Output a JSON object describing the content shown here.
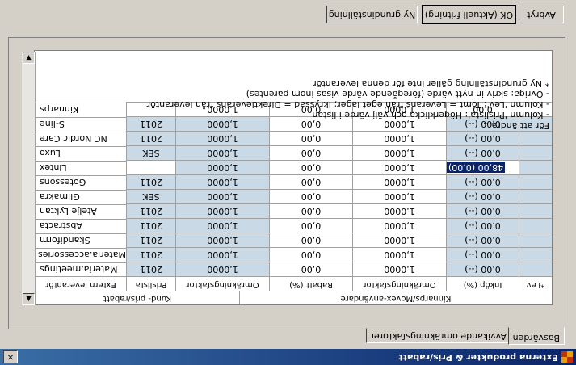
{
  "window": {
    "title": "Externa produkter & Pris/rabatt",
    "close_glyph": "×"
  },
  "tabs": [
    {
      "label": "Basvärden"
    },
    {
      "label": "Avvikande omräkningsfaktorer"
    }
  ],
  "grid": {
    "group_headers": [
      "Kinnarps/Movex-användare",
      "Kund- pris/rabatt"
    ],
    "columns": [
      "*Lev",
      "Inköp (%)",
      "Omräkningsfaktor",
      "Rabatt (%)",
      "Omräkningsfaktor",
      "Prislista",
      "Extern leverantör"
    ],
    "rows": [
      {
        "lev": "",
        "inkop": "0,00 (--)",
        "omr1": "1,0000",
        "rabatt": "0,00",
        "omr2": "1,0000",
        "prislista": "2011",
        "extern": "Materia.meetings"
      },
      {
        "lev": "",
        "inkop": "0,00 (--)",
        "omr1": "1,0000",
        "rabatt": "0,00",
        "omr2": "1,0000",
        "prislista": "2011",
        "extern": "Materia.accessories"
      },
      {
        "lev": "",
        "inkop": "0,00 (--)",
        "omr1": "1,0000",
        "rabatt": "0,00",
        "omr2": "1,0000",
        "prislista": "2011",
        "extern": "Skandiform"
      },
      {
        "lev": "",
        "inkop": "0,00 (--)",
        "omr1": "1,0000",
        "rabatt": "0,00",
        "omr2": "1,0000",
        "prislista": "2011",
        "extern": "Abstracta"
      },
      {
        "lev": "",
        "inkop": "0,00 (--)",
        "omr1": "1,0000",
        "rabatt": "0,00",
        "omr2": "1,0000",
        "prislista": "2011",
        "extern": "Atelje Lyktan"
      },
      {
        "lev": "",
        "inkop": "0,00 (--)",
        "omr1": "1,0000",
        "rabatt": "0,00",
        "omr2": "1,0000",
        "prislista": "SEK",
        "extern": "Glimakra"
      },
      {
        "lev": "",
        "inkop": "0,00 (--)",
        "omr1": "1,0000",
        "rabatt": "0,00",
        "omr2": "1,0000",
        "prislista": "2011",
        "extern": "Gotessons"
      },
      {
        "lev": "",
        "inkop": "48,00 (0,00)",
        "omr1": "1,0000",
        "rabatt": "0,00",
        "omr2": "1,0000",
        "prislista": "",
        "extern": "Lintex"
      },
      {
        "lev": "",
        "inkop": "0,00 (--)",
        "omr1": "1,0000",
        "rabatt": "0,00",
        "omr2": "1,0000",
        "prislista": "SEK",
        "extern": "Luxo"
      },
      {
        "lev": "",
        "inkop": "0,00 (--)",
        "omr1": "1,0000",
        "rabatt": "0,00",
        "omr2": "1,0000",
        "prislista": "2011",
        "extern": "NC Nordic Care"
      },
      {
        "lev": "",
        "inkop": "0,00 (--)",
        "omr1": "1,0000",
        "rabatt": "0,00",
        "omr2": "1,0000",
        "prislista": "2011",
        "extern": "S-line"
      },
      {
        "lev": "",
        "inkop": "0,00",
        "omr1": "1,0000",
        "rabatt": "0,00",
        "omr2": "1,0000",
        "prislista": "",
        "extern": "Kinnarps"
      }
    ]
  },
  "notes": [
    "För att ändra...",
    "- Kolumn 'Prislista': Högerklicka och välj värde i listan",
    "- Kolumn 'Lev': Tomt = Leverans från eget lager; Ikryssad = Direktleverans från leverantör",
    "- Övriga: skriv in nytt värde (föregående värde visas inom parentes)",
    "* Ny grundinställning gäller inte för denna leverantör"
  ],
  "buttons": {
    "cancel": "Avbryt",
    "ok": "OK (Aktuell fritning)",
    "reset": "Ny grundinställning"
  },
  "colors": {
    "grid_cell": "#c9d9e5",
    "selection": "#0a246a",
    "titlebar": "#0a246a"
  }
}
